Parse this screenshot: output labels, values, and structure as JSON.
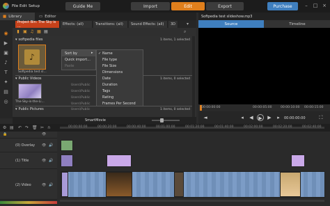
{
  "app": {
    "menu": [
      "File",
      "Edit",
      "Setup"
    ],
    "buttons": {
      "guide": "Guide Me",
      "import": "Import",
      "edit": "Edit",
      "export": "Export",
      "purchase": "Purchase"
    },
    "brand_color": "#e07f1c"
  },
  "library": {
    "tab_library": "Library",
    "tab_editor": "Editor",
    "project_tab": "Project Bin: The Sky is ...",
    "tabs": [
      "Effects: (all)",
      "Transitions: (all)",
      "Sound Effects: (all)",
      "3D"
    ],
    "groups": [
      {
        "name": "softpedia files",
        "status": "1 items, 1 selected",
        "thumb_caption": "Softpedia test sl..."
      },
      {
        "name": "Public Videos",
        "status": "1 items, 0 selected",
        "thumb_caption": "The-Sky-is-the-Li..."
      },
      {
        "name": "Public Pictures",
        "status": "1 items, 0 selected"
      }
    ],
    "path_fragments": [
      "Users\\Public",
      "Users\\Public",
      "Users\\Public",
      "Users\\Public",
      "Users\\Public",
      "Users\\Public"
    ],
    "smartmovie": "SmartMovie"
  },
  "context_menu": {
    "items": [
      {
        "label": "Sort by",
        "dim": false,
        "arrow": "▸"
      },
      {
        "label": "Quick import...",
        "dim": false
      },
      {
        "label": "Paste",
        "dim": true
      }
    ],
    "submenu": [
      {
        "label": "Name",
        "checked": true
      },
      {
        "label": "File type"
      },
      {
        "label": "File Size"
      },
      {
        "label": "Dimensions"
      },
      {
        "label": "Date"
      },
      {
        "label": "Duration"
      },
      {
        "label": "Tags"
      },
      {
        "label": "Rating"
      },
      {
        "label": "Frames Per Second"
      }
    ]
  },
  "preview": {
    "title": "Softpedia test slideshow.mp3",
    "tabs": [
      "Source",
      "Timeline"
    ],
    "ruler": [
      "00:00:00:00",
      "00:00:05:00",
      "00:00:10:00",
      "00:00:15:00"
    ],
    "timecode": "00:00:00:00"
  },
  "timeline": {
    "tracks": [
      {
        "label": "",
        "name": "audio"
      },
      {
        "label": "(0) Overlay",
        "name": "overlay"
      },
      {
        "label": "(1) Title",
        "name": "title"
      },
      {
        "label": "(2) Video",
        "name": "video"
      }
    ],
    "ruler": [
      "00:00:00:00",
      "00:00:20:00",
      "00:00:40:00",
      "00:01:00:00",
      "00:01:20:00",
      "00:01:40:00",
      "00:02:00:00",
      "00:02:20:00",
      "00:02:40:00"
    ]
  }
}
